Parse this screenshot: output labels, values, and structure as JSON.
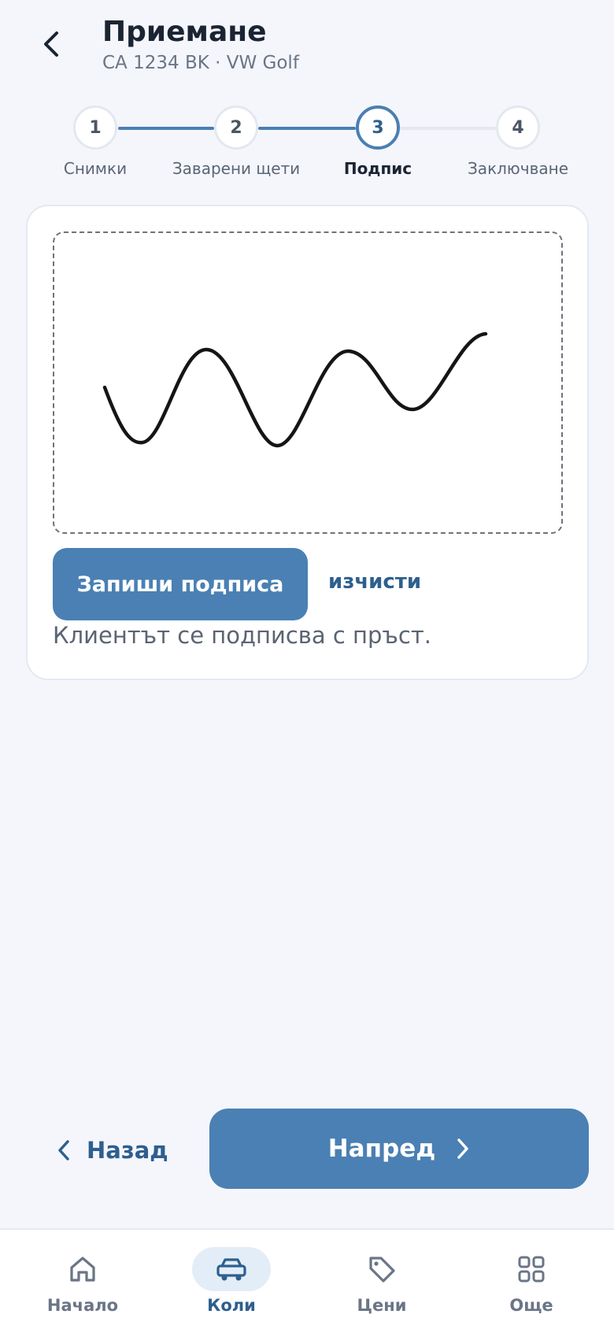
{
  "header": {
    "title": "Приемане",
    "subtitle": "CA 1234 BK · VW Golf",
    "back_icon": "chevron-left-icon"
  },
  "stepper": {
    "active_index": 2,
    "steps": [
      {
        "number": "1",
        "label": "Снимки"
      },
      {
        "number": "2",
        "label": "Заварени щети"
      },
      {
        "number": "3",
        "label": "Подпис"
      },
      {
        "number": "4",
        "label": "Заключване"
      }
    ]
  },
  "signature": {
    "save_label": "Запиши подписа",
    "clear_label": "изчисти",
    "hint": "Клиентът се подписва с пръст."
  },
  "actions": {
    "back_label": "Назад",
    "next_label": "Напред"
  },
  "bottom_nav": {
    "items": [
      {
        "label": "Начало",
        "icon": "home-icon"
      },
      {
        "label": "Коли",
        "icon": "car-icon"
      },
      {
        "label": "Цени",
        "icon": "tag-icon"
      },
      {
        "label": "Още",
        "icon": "grid-icon"
      }
    ],
    "active_index": 1
  },
  "colors": {
    "accent": "#4a80b3",
    "accent_dark": "#2e5f8e",
    "background": "#f4f6fb"
  }
}
